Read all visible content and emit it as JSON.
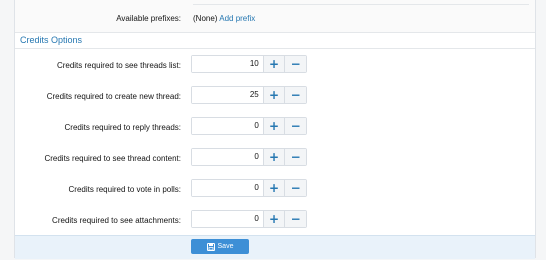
{
  "prefixes": {
    "label": "Available prefixes:",
    "value": "(None)",
    "add_link": "Add prefix"
  },
  "section": {
    "title": "Credits Options"
  },
  "fields": [
    {
      "label": "Credits required to see threads list:",
      "value": "10"
    },
    {
      "label": "Credits required to create new thread:",
      "value": "25"
    },
    {
      "label": "Credits required to reply threads:",
      "value": "0"
    },
    {
      "label": "Credits required to see thread content:",
      "value": "0"
    },
    {
      "label": "Credits required to vote in polls:",
      "value": "0"
    },
    {
      "label": "Credits required to see attachments:",
      "value": "0"
    }
  ],
  "stepper": {
    "plus": "+",
    "minus": "−"
  },
  "footer": {
    "save_label": "Save"
  },
  "icons": {
    "save": "floppy-disk-icon"
  },
  "colors": {
    "accent": "#2577b1",
    "button": "#3d8fd6",
    "footer_bg": "#e9f2fa"
  }
}
